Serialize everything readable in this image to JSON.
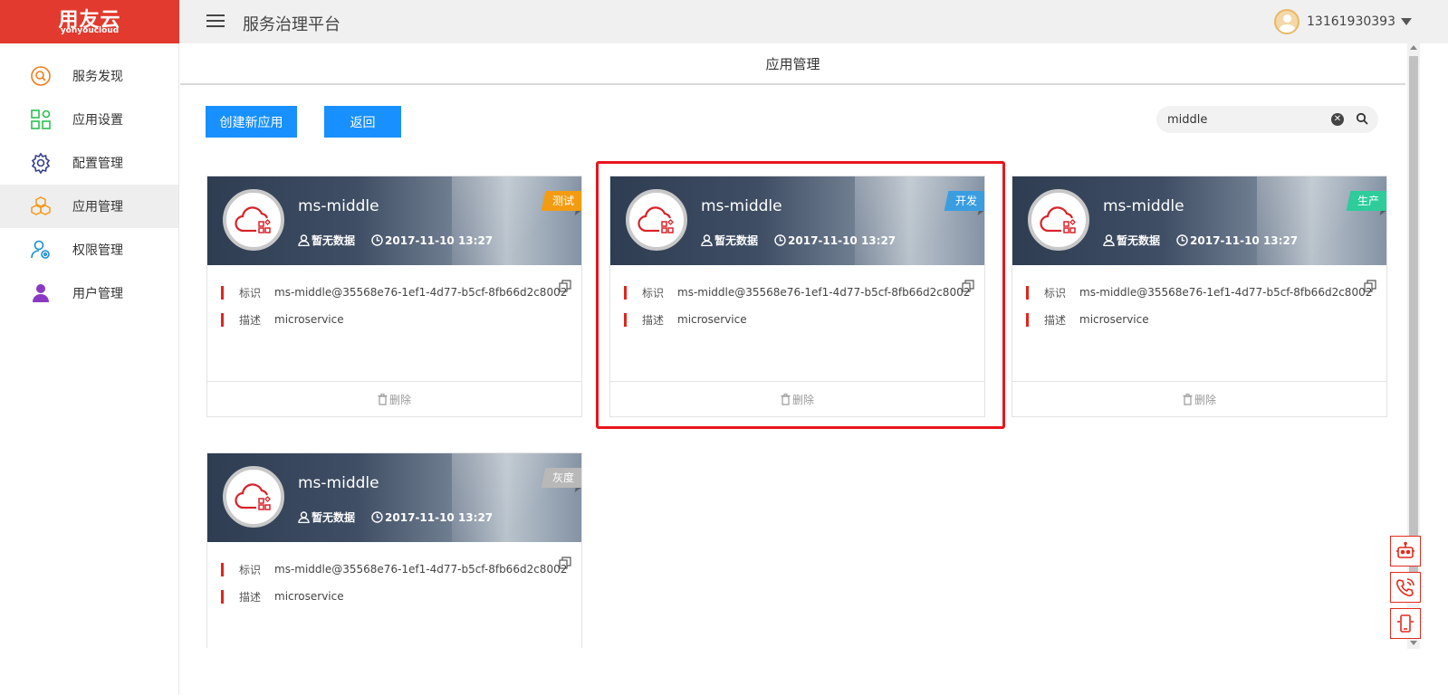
{
  "header": {
    "logo_text": "用友云",
    "logo_sub": "yonyoucloud",
    "platform_title": "服务治理平台",
    "username": "13161930393"
  },
  "sidebar": {
    "items": [
      {
        "label": "服务发现",
        "icon": "search-circle-icon",
        "color": "#f07c1b"
      },
      {
        "label": "应用设置",
        "icon": "app-grid-icon",
        "color": "#2bbf4f"
      },
      {
        "label": "配置管理",
        "icon": "gear-icon",
        "color": "#33408f"
      },
      {
        "label": "应用管理",
        "icon": "cubes-icon",
        "color": "#f59a1b",
        "active": true
      },
      {
        "label": "权限管理",
        "icon": "user-gear-icon",
        "color": "#1a8fd6"
      },
      {
        "label": "用户管理",
        "icon": "user-icon",
        "color": "#8a3ac2"
      }
    ]
  },
  "main": {
    "title": "应用管理",
    "create_button": "创建新应用",
    "back_button": "返回",
    "search": {
      "value": "middle"
    }
  },
  "cards": [
    {
      "name": "ms-middle",
      "owner": "暂无数据",
      "time": "2017-11-10 13:27",
      "env": "测试",
      "env_color": "#f39c12",
      "id_label": "标识",
      "id_value": "ms-middle@35568e76-1ef1-4d77-b5cf-8fb66d2c8002",
      "desc_label": "描述",
      "desc_value": "microservice",
      "delete_label": "删除"
    },
    {
      "name": "ms-middle",
      "owner": "暂无数据",
      "time": "2017-11-10 13:27",
      "env": "开发",
      "env_color": "#3a9de0",
      "id_label": "标识",
      "id_value": "ms-middle@35568e76-1ef1-4d77-b5cf-8fb66d2c8002",
      "desc_label": "描述",
      "desc_value": "microservice",
      "delete_label": "删除"
    },
    {
      "name": "ms-middle",
      "owner": "暂无数据",
      "time": "2017-11-10 13:27",
      "env": "生产",
      "env_color": "#2ecc9b",
      "id_label": "标识",
      "id_value": "ms-middle@35568e76-1ef1-4d77-b5cf-8fb66d2c8002",
      "desc_label": "描述",
      "desc_value": "microservice",
      "delete_label": "删除"
    },
    {
      "name": "ms-middle",
      "owner": "暂无数据",
      "time": "2017-11-10 13:27",
      "env": "灰度",
      "env_color": "#b8b8b8",
      "id_label": "标识",
      "id_value": "ms-middle@35568e76-1ef1-4d77-b5cf-8fb66d2c8002",
      "desc_label": "描述",
      "desc_value": "microservice",
      "delete_label": "删除"
    }
  ],
  "float_tools": [
    "robot-icon",
    "phone-icon",
    "mobile-icon"
  ]
}
